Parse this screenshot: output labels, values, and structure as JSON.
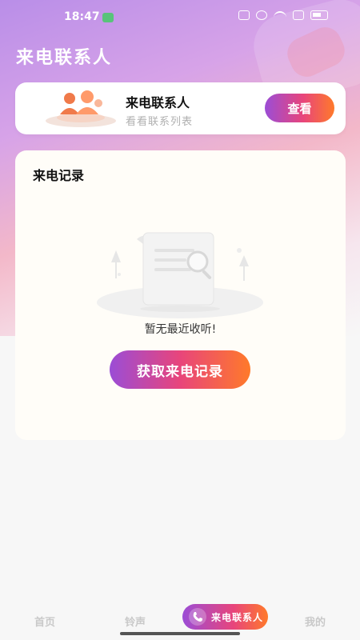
{
  "status_bar": {
    "time": "18:47"
  },
  "header": {
    "title": "来电联系人"
  },
  "contact_card": {
    "title": "来电联系人",
    "subtitle": "看看联系列表",
    "view_label": "查看"
  },
  "record_card": {
    "title": "来电记录",
    "empty_text": "暂无最近收听!",
    "fetch_label": "获取来电记录"
  },
  "bottom_nav": {
    "items": [
      {
        "label": "首页"
      },
      {
        "label": "铃声"
      },
      {
        "label": "来电联系人"
      },
      {
        "label": "我的"
      }
    ],
    "active_index": 2
  },
  "colors": {
    "accent_start": "#9b4dd6",
    "accent_mid": "#e8457b",
    "accent_end": "#ff7a2a"
  },
  "icons": {
    "contacts_illustration": "people-icon",
    "empty_state": "document-search-icon",
    "nav_active": "phone-icon"
  }
}
